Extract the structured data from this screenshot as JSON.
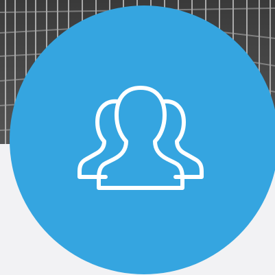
{
  "colors": {
    "page_background": "#f2f2f4",
    "badge": "#35a5e0",
    "icon_stroke": "#ffffff",
    "photo_dark": "#2a2a2a",
    "photo_light": "#bdbdbd"
  },
  "icons": {
    "badge_icon": "users-group-icon",
    "background_photo": "building-facade-photo"
  }
}
